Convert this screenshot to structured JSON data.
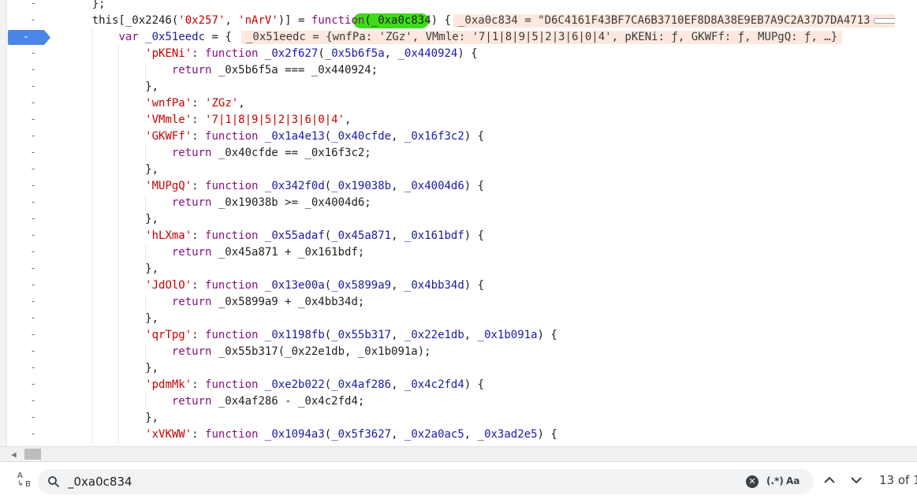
{
  "editor": {
    "breakpoint_marker": "-",
    "active_breakpoint_label": "-",
    "lines": [
      {
        "indent": "    ",
        "html": "};"
      },
      {
        "indent": "    ",
        "segments": [
          [
            "this[_0x2246(",
            "ph"
          ],
          [
            "'0x257'",
            "s"
          ],
          [
            ", ",
            "ph"
          ],
          [
            "'nArV'",
            "s"
          ],
          [
            ")] = ",
            "ph"
          ],
          [
            "function",
            "k"
          ],
          [
            "(_0xa0c834) {",
            "ph"
          ]
        ],
        "inline": "_0xa0c834 = \"D6C4161F43BF7CA6B3710EF8D8A38E9EB7A9C2A37D7DA4713"
      },
      {
        "indent": "        ",
        "segments": [
          [
            "var",
            "k"
          ],
          [
            " ",
            "ph"
          ],
          [
            "_0x51eedc",
            "v"
          ],
          [
            " = {",
            "ph"
          ]
        ],
        "inline": "_0x51eedc = {wnfPa: 'ZGz', VMmle: '7|1|8|9|5|2|3|6|0|4', pKENi: ƒ, GKWFf: ƒ, MUPgQ: ƒ, …}"
      },
      {
        "indent": "            ",
        "segments": [
          [
            "'pKENi'",
            "s"
          ],
          [
            ": ",
            "ph"
          ],
          [
            "function",
            "k"
          ],
          [
            " ",
            "ph"
          ],
          [
            "_0x2f627",
            "v"
          ],
          [
            "(",
            "ph"
          ],
          [
            "_0x5b6f5a",
            "v"
          ],
          [
            ", ",
            "ph"
          ],
          [
            "_0x440924",
            "v"
          ],
          [
            ") {",
            "ph"
          ]
        ]
      },
      {
        "indent": "                ",
        "segments": [
          [
            "return",
            "k"
          ],
          [
            " _0x5b6f5a === _0x440924;",
            "ph"
          ]
        ]
      },
      {
        "indent": "            ",
        "segments": [
          [
            "},",
            "ph"
          ]
        ]
      },
      {
        "indent": "            ",
        "segments": [
          [
            "'wnfPa'",
            "s"
          ],
          [
            ": ",
            "ph"
          ],
          [
            "'ZGz'",
            "s"
          ],
          [
            ",",
            "ph"
          ]
        ]
      },
      {
        "indent": "            ",
        "segments": [
          [
            "'VMmle'",
            "s"
          ],
          [
            ": ",
            "ph"
          ],
          [
            "'7|1|8|9|5|2|3|6|0|4'",
            "s"
          ],
          [
            ",",
            "ph"
          ]
        ]
      },
      {
        "indent": "            ",
        "segments": [
          [
            "'GKWFf'",
            "s"
          ],
          [
            ": ",
            "ph"
          ],
          [
            "function",
            "k"
          ],
          [
            " ",
            "ph"
          ],
          [
            "_0x1a4e13",
            "v"
          ],
          [
            "(",
            "ph"
          ],
          [
            "_0x40cfde",
            "v"
          ],
          [
            ", ",
            "ph"
          ],
          [
            "_0x16f3c2",
            "v"
          ],
          [
            ") {",
            "ph"
          ]
        ]
      },
      {
        "indent": "                ",
        "segments": [
          [
            "return",
            "k"
          ],
          [
            " _0x40cfde == _0x16f3c2;",
            "ph"
          ]
        ]
      },
      {
        "indent": "            ",
        "segments": [
          [
            "},",
            "ph"
          ]
        ]
      },
      {
        "indent": "            ",
        "segments": [
          [
            "'MUPgQ'",
            "s"
          ],
          [
            ": ",
            "ph"
          ],
          [
            "function",
            "k"
          ],
          [
            " ",
            "ph"
          ],
          [
            "_0x342f0d",
            "v"
          ],
          [
            "(",
            "ph"
          ],
          [
            "_0x19038b",
            "v"
          ],
          [
            ", ",
            "ph"
          ],
          [
            "_0x4004d6",
            "v"
          ],
          [
            ") {",
            "ph"
          ]
        ]
      },
      {
        "indent": "                ",
        "segments": [
          [
            "return",
            "k"
          ],
          [
            " _0x19038b >= _0x4004d6;",
            "ph"
          ]
        ]
      },
      {
        "indent": "            ",
        "segments": [
          [
            "},",
            "ph"
          ]
        ]
      },
      {
        "indent": "            ",
        "segments": [
          [
            "'hLXma'",
            "s"
          ],
          [
            ": ",
            "ph"
          ],
          [
            "function",
            "k"
          ],
          [
            " ",
            "ph"
          ],
          [
            "_0x55adaf",
            "v"
          ],
          [
            "(",
            "ph"
          ],
          [
            "_0x45a871",
            "v"
          ],
          [
            ", ",
            "ph"
          ],
          [
            "_0x161bdf",
            "v"
          ],
          [
            ") {",
            "ph"
          ]
        ]
      },
      {
        "indent": "                ",
        "segments": [
          [
            "return",
            "k"
          ],
          [
            " _0x45a871 + _0x161bdf;",
            "ph"
          ]
        ]
      },
      {
        "indent": "            ",
        "segments": [
          [
            "},",
            "ph"
          ]
        ]
      },
      {
        "indent": "            ",
        "segments": [
          [
            "'JdOlO'",
            "s"
          ],
          [
            ": ",
            "ph"
          ],
          [
            "function",
            "k"
          ],
          [
            " ",
            "ph"
          ],
          [
            "_0x13e00a",
            "v"
          ],
          [
            "(",
            "ph"
          ],
          [
            "_0x5899a9",
            "v"
          ],
          [
            ", ",
            "ph"
          ],
          [
            "_0x4bb34d",
            "v"
          ],
          [
            ") {",
            "ph"
          ]
        ]
      },
      {
        "indent": "                ",
        "segments": [
          [
            "return",
            "k"
          ],
          [
            " _0x5899a9 + _0x4bb34d;",
            "ph"
          ]
        ]
      },
      {
        "indent": "            ",
        "segments": [
          [
            "},",
            "ph"
          ]
        ]
      },
      {
        "indent": "            ",
        "segments": [
          [
            "'qrTpg'",
            "s"
          ],
          [
            ": ",
            "ph"
          ],
          [
            "function",
            "k"
          ],
          [
            " ",
            "ph"
          ],
          [
            "_0x1198fb",
            "v"
          ],
          [
            "(",
            "ph"
          ],
          [
            "_0x55b317",
            "v"
          ],
          [
            ", ",
            "ph"
          ],
          [
            "_0x22e1db",
            "v"
          ],
          [
            ", ",
            "ph"
          ],
          [
            "_0x1b091a",
            "v"
          ],
          [
            ") {",
            "ph"
          ]
        ]
      },
      {
        "indent": "                ",
        "segments": [
          [
            "return",
            "k"
          ],
          [
            " _0x55b317(_0x22e1db, _0x1b091a);",
            "ph"
          ]
        ]
      },
      {
        "indent": "            ",
        "segments": [
          [
            "},",
            "ph"
          ]
        ]
      },
      {
        "indent": "            ",
        "segments": [
          [
            "'pdmMk'",
            "s"
          ],
          [
            ": ",
            "ph"
          ],
          [
            "function",
            "k"
          ],
          [
            " ",
            "ph"
          ],
          [
            "_0xe2b022",
            "v"
          ],
          [
            "(",
            "ph"
          ],
          [
            "_0x4af286",
            "v"
          ],
          [
            ", ",
            "ph"
          ],
          [
            "_0x4c2fd4",
            "v"
          ],
          [
            ") {",
            "ph"
          ]
        ]
      },
      {
        "indent": "                ",
        "segments": [
          [
            "return",
            "k"
          ],
          [
            " _0x4af286 - _0x4c2fd4;",
            "ph"
          ]
        ]
      },
      {
        "indent": "            ",
        "segments": [
          [
            "},",
            "ph"
          ]
        ]
      },
      {
        "indent": "            ",
        "segments": [
          [
            "'xVKWW'",
            "s"
          ],
          [
            ": ",
            "ph"
          ],
          [
            "function",
            "k"
          ],
          [
            " ",
            "ph"
          ],
          [
            "_0x1094a3",
            "v"
          ],
          [
            "(",
            "ph"
          ],
          [
            "_0x5f3627",
            "v"
          ],
          [
            ", ",
            "ph"
          ],
          [
            "_0x2a0ac5",
            "v"
          ],
          [
            ", ",
            "ph"
          ],
          [
            "_0x3ad2e5",
            "v"
          ],
          [
            ") {",
            "ph"
          ]
        ]
      }
    ]
  },
  "search": {
    "query": "_0xa0c834",
    "match_count": "13 of 1",
    "regex_label": "(.*)",
    "case_label": "Aa",
    "case_icon_top": "A",
    "case_icon_bottom": "B"
  },
  "colors": {
    "highlight": "#3ddc15",
    "breakpoint": "#4a86e8",
    "inline_value_bg": "#fce8df"
  }
}
